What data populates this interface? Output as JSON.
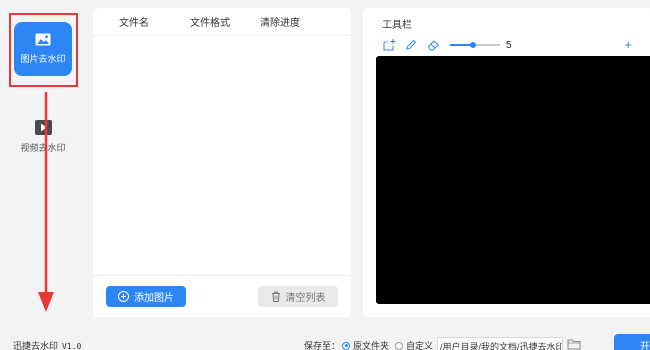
{
  "sidebar": {
    "items": [
      {
        "label": "图片去水印",
        "icon": "image-icon",
        "active": true
      },
      {
        "label": "视频去水印",
        "icon": "video-icon",
        "active": false
      }
    ]
  },
  "file_list": {
    "columns": [
      "文件名",
      "文件格式",
      "清除进度"
    ],
    "add_button": "添加图片",
    "clear_button": "清空列表"
  },
  "toolbar": {
    "title": "工具栏",
    "brush_size": "5",
    "icons": [
      "select-rect-icon",
      "pen-icon",
      "eraser-icon",
      "add-icon"
    ]
  },
  "footer": {
    "app_name": "迅捷去水印",
    "version": "V1.0",
    "save_label": "保存至：",
    "option_original": "原文件夹",
    "option_custom": "自定义",
    "path": "/用户目录/我的文档/迅捷去水印",
    "start_button": "开"
  },
  "colors": {
    "accent": "#2c86f5",
    "highlight": "#e53935",
    "preview_bg": "#000000"
  }
}
